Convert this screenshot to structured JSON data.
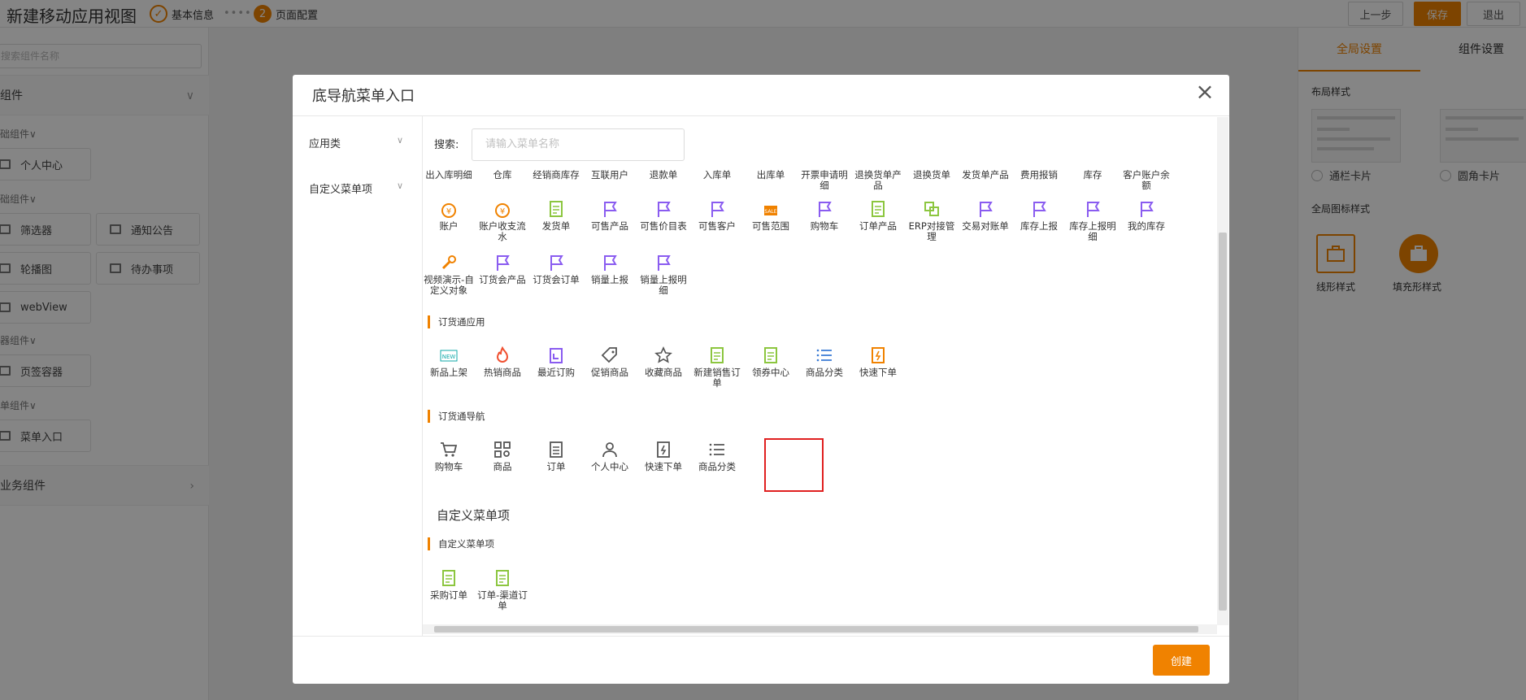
{
  "header": {
    "title": "新建移动应用视图",
    "step1": "基本信息",
    "step2_num": "2",
    "step2": "页面配置",
    "dots": "••••",
    "prev": "上一步",
    "save": "保存",
    "exit": "退出"
  },
  "left": {
    "search_placeholder": "搜索组件名称",
    "group1": "组件",
    "group2": "业务组件",
    "sub1": "础组件∨",
    "sub2": "础组件∨",
    "sub3": "器组件∨",
    "sub4": "单组件∨",
    "items": [
      "个人中心",
      "筛选器",
      "通知公告",
      "轮播图",
      "待办事项",
      "webView",
      "页签容器",
      "菜单入口"
    ]
  },
  "right": {
    "tab1": "全局设置",
    "tab2": "组件设置",
    "layout_title": "布局样式",
    "layout_opt1": "通栏卡片",
    "layout_opt2": "圆角卡片",
    "icon_title": "全局图标样式",
    "icon_opt1": "线形样式",
    "icon_opt2": "填充形样式"
  },
  "modal": {
    "title": "底导航菜单入口",
    "categories": [
      "应用类",
      "自定义菜单项"
    ],
    "search_label": "搜索:",
    "search_placeholder": "请输入菜单名称",
    "row1": [
      "出入库明细",
      "仓库",
      "经销商库存",
      "互联用户",
      "退款单",
      "入库单",
      "出库单",
      "开票申请明细",
      "退换货单产品",
      "退换货单",
      "发货单产品",
      "费用报销",
      "库存",
      "客户账户余额"
    ],
    "row2": [
      "账户",
      "账户收支流水",
      "发货单",
      "可售产品",
      "可售价目表",
      "可售客户",
      "可售范围",
      "购物车",
      "订单产品",
      "ERP对接管理",
      "交易对账单",
      "库存上报",
      "库存上报明细",
      "我的库存"
    ],
    "row3": [
      "视频演示-自定义对象",
      "订货会产品",
      "订货会订单",
      "销量上报",
      "销量上报明细"
    ],
    "section1": "订货通应用",
    "row4": [
      "新品上架",
      "热销商品",
      "最近订购",
      "促销商品",
      "收藏商品",
      "新建销售订单",
      "领券中心",
      "商品分类",
      "快速下单"
    ],
    "section2": "订货通导航",
    "row5": [
      "购物车",
      "商品",
      "订单",
      "个人中心",
      "快速下单",
      "商品分类"
    ],
    "custom_title": "自定义菜单项",
    "section3": "自定义菜单项",
    "row6": [
      "采购订单",
      "订单-渠道订单"
    ],
    "create": "创建",
    "close": "×"
  },
  "colors": {
    "accent": "#f08200",
    "flag": "#8a5cf0",
    "green": "#8cc63f",
    "blue": "#3a7bd5",
    "highlight": "#e02020"
  }
}
